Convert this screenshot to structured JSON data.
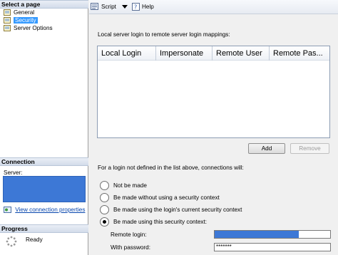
{
  "left": {
    "select_page_header": "Select a page",
    "pages": [
      {
        "label": "General",
        "icon": "page-icon"
      },
      {
        "label": "Security",
        "icon": "page-icon"
      },
      {
        "label": "Server Options",
        "icon": "page-icon"
      }
    ],
    "connection_header": "Connection",
    "server_label": "Server:",
    "view_connection_properties": "View connection properties",
    "progress_header": "Progress",
    "progress_status": "Ready"
  },
  "toolbar": {
    "script_label": "Script",
    "help_label": "Help"
  },
  "main": {
    "mapping_label": "Local server login to remote server login mappings:",
    "columns": [
      "Local Login",
      "Impersonate",
      "Remote User",
      "Remote Pas..."
    ],
    "add_label": "Add",
    "remove_label": "Remove",
    "undefined_login_label": "For a login not defined in the list above, connections will:",
    "options": [
      {
        "label": "Not be made",
        "checked": false
      },
      {
        "label": "Be made without using a security context",
        "checked": false
      },
      {
        "label": "Be made using the login's current security context",
        "checked": false
      },
      {
        "label": "Be made using this security context:",
        "checked": true
      }
    ],
    "remote_login_label": "Remote login:",
    "password_label": "With password:",
    "password_value": "*******"
  },
  "colors": {
    "selection": "#3399ff",
    "masked_field": "#3d78d6"
  }
}
